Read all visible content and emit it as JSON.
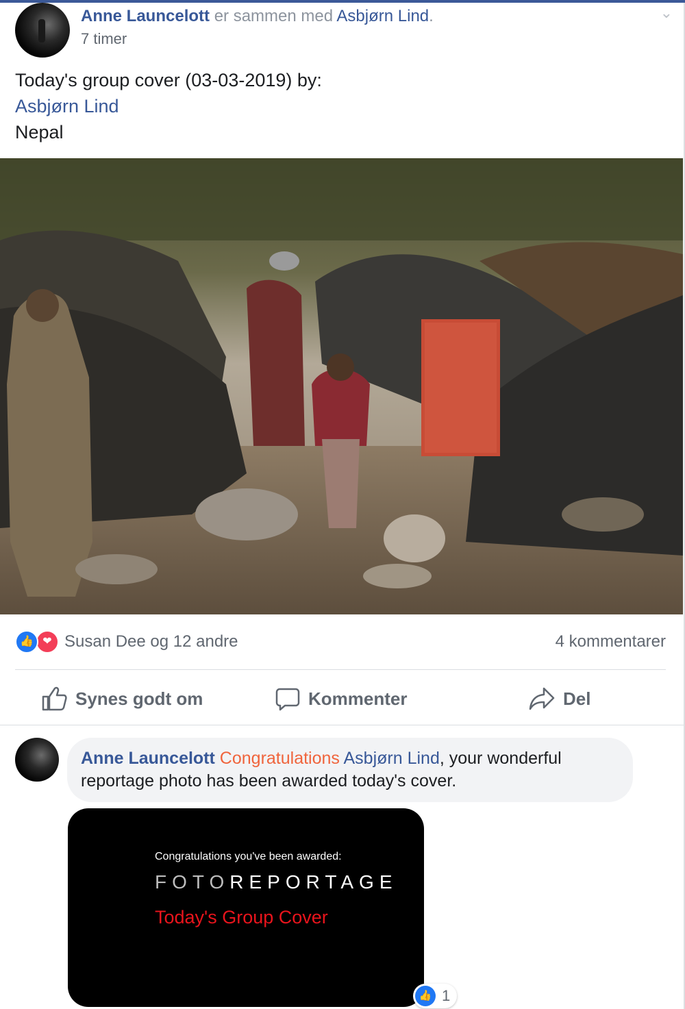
{
  "post": {
    "author": "Anne Launcelott",
    "with_text": "er sammen med",
    "tagged": "Asbjørn Lind",
    "period": ".",
    "time": "7 timer",
    "text_line1": "Today's group cover (03-03-2019) by:",
    "text_link": "Asbjørn Lind",
    "text_line3": "Nepal"
  },
  "reactions": {
    "names": "Susan Dee og 12 andre",
    "comments": "4 kommentarer"
  },
  "actions": {
    "like": "Synes godt om",
    "comment": "Kommenter",
    "share": "Del"
  },
  "comment": {
    "author": "Anne Launcelott",
    "congrats": "Congratulations",
    "mention": "Asbjørn Lind",
    "text": ", your wonderful reportage photo has been awarded today's cover.",
    "like_count": "1"
  },
  "award_card": {
    "line1": "Congratulations  you've been awarded:",
    "foto": "FOTO",
    "reportage": "REPORTAGE",
    "line3": "Today's  Group  Cover"
  },
  "colors": {
    "link": "#385898",
    "congrats": "#f0643c",
    "like_blue": "#2078f4",
    "love_red": "#f33e58",
    "award_red": "#e8141c"
  }
}
